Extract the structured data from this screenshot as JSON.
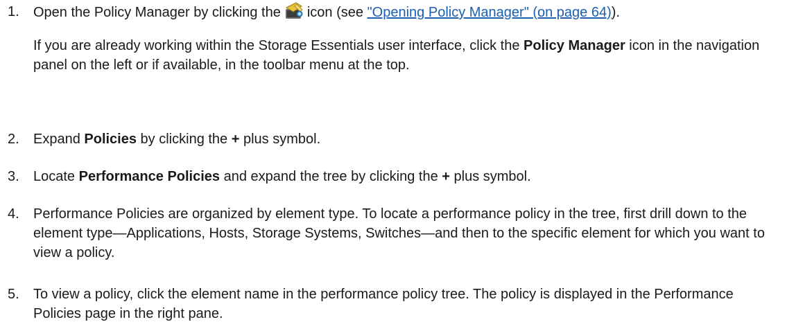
{
  "steps": [
    {
      "num": "1.",
      "before_icon": "Open the Policy Manager by clicking the",
      "icon": "policy-manager-icon",
      "after_icon": "icon (see",
      "link": "\"Opening Policy Manager\" (on page 64)",
      "after_link": ").",
      "note_before": "If you are already working within the Storage Essentials user interface, click the ",
      "note_bold": "Policy Manager",
      "note_after": " icon in the navigation panel on the left or if available, in the toolbar menu at the top."
    },
    {
      "num": "2.",
      "t1": "Expand ",
      "b1": "Policies",
      "t2": " by clicking the ",
      "b2": "+",
      "t3": " plus symbol."
    },
    {
      "num": "3.",
      "t1": "Locate ",
      "b1": "Performance Policies",
      "t2": " and expand the tree by clicking the ",
      "b2": "+",
      "t3": " plus symbol."
    },
    {
      "num": "4.",
      "text": "Performance Policies are organized by element type. To locate a performance policy in the tree, first drill down to the element type—Applications, Hosts, Storage Systems, Switches—and then to the specific element for which you want to view a policy."
    },
    {
      "num": "5.",
      "text": "To view a policy, click the element name in the performance policy tree. The policy is displayed in the Performance Policies page in the right pane."
    }
  ]
}
